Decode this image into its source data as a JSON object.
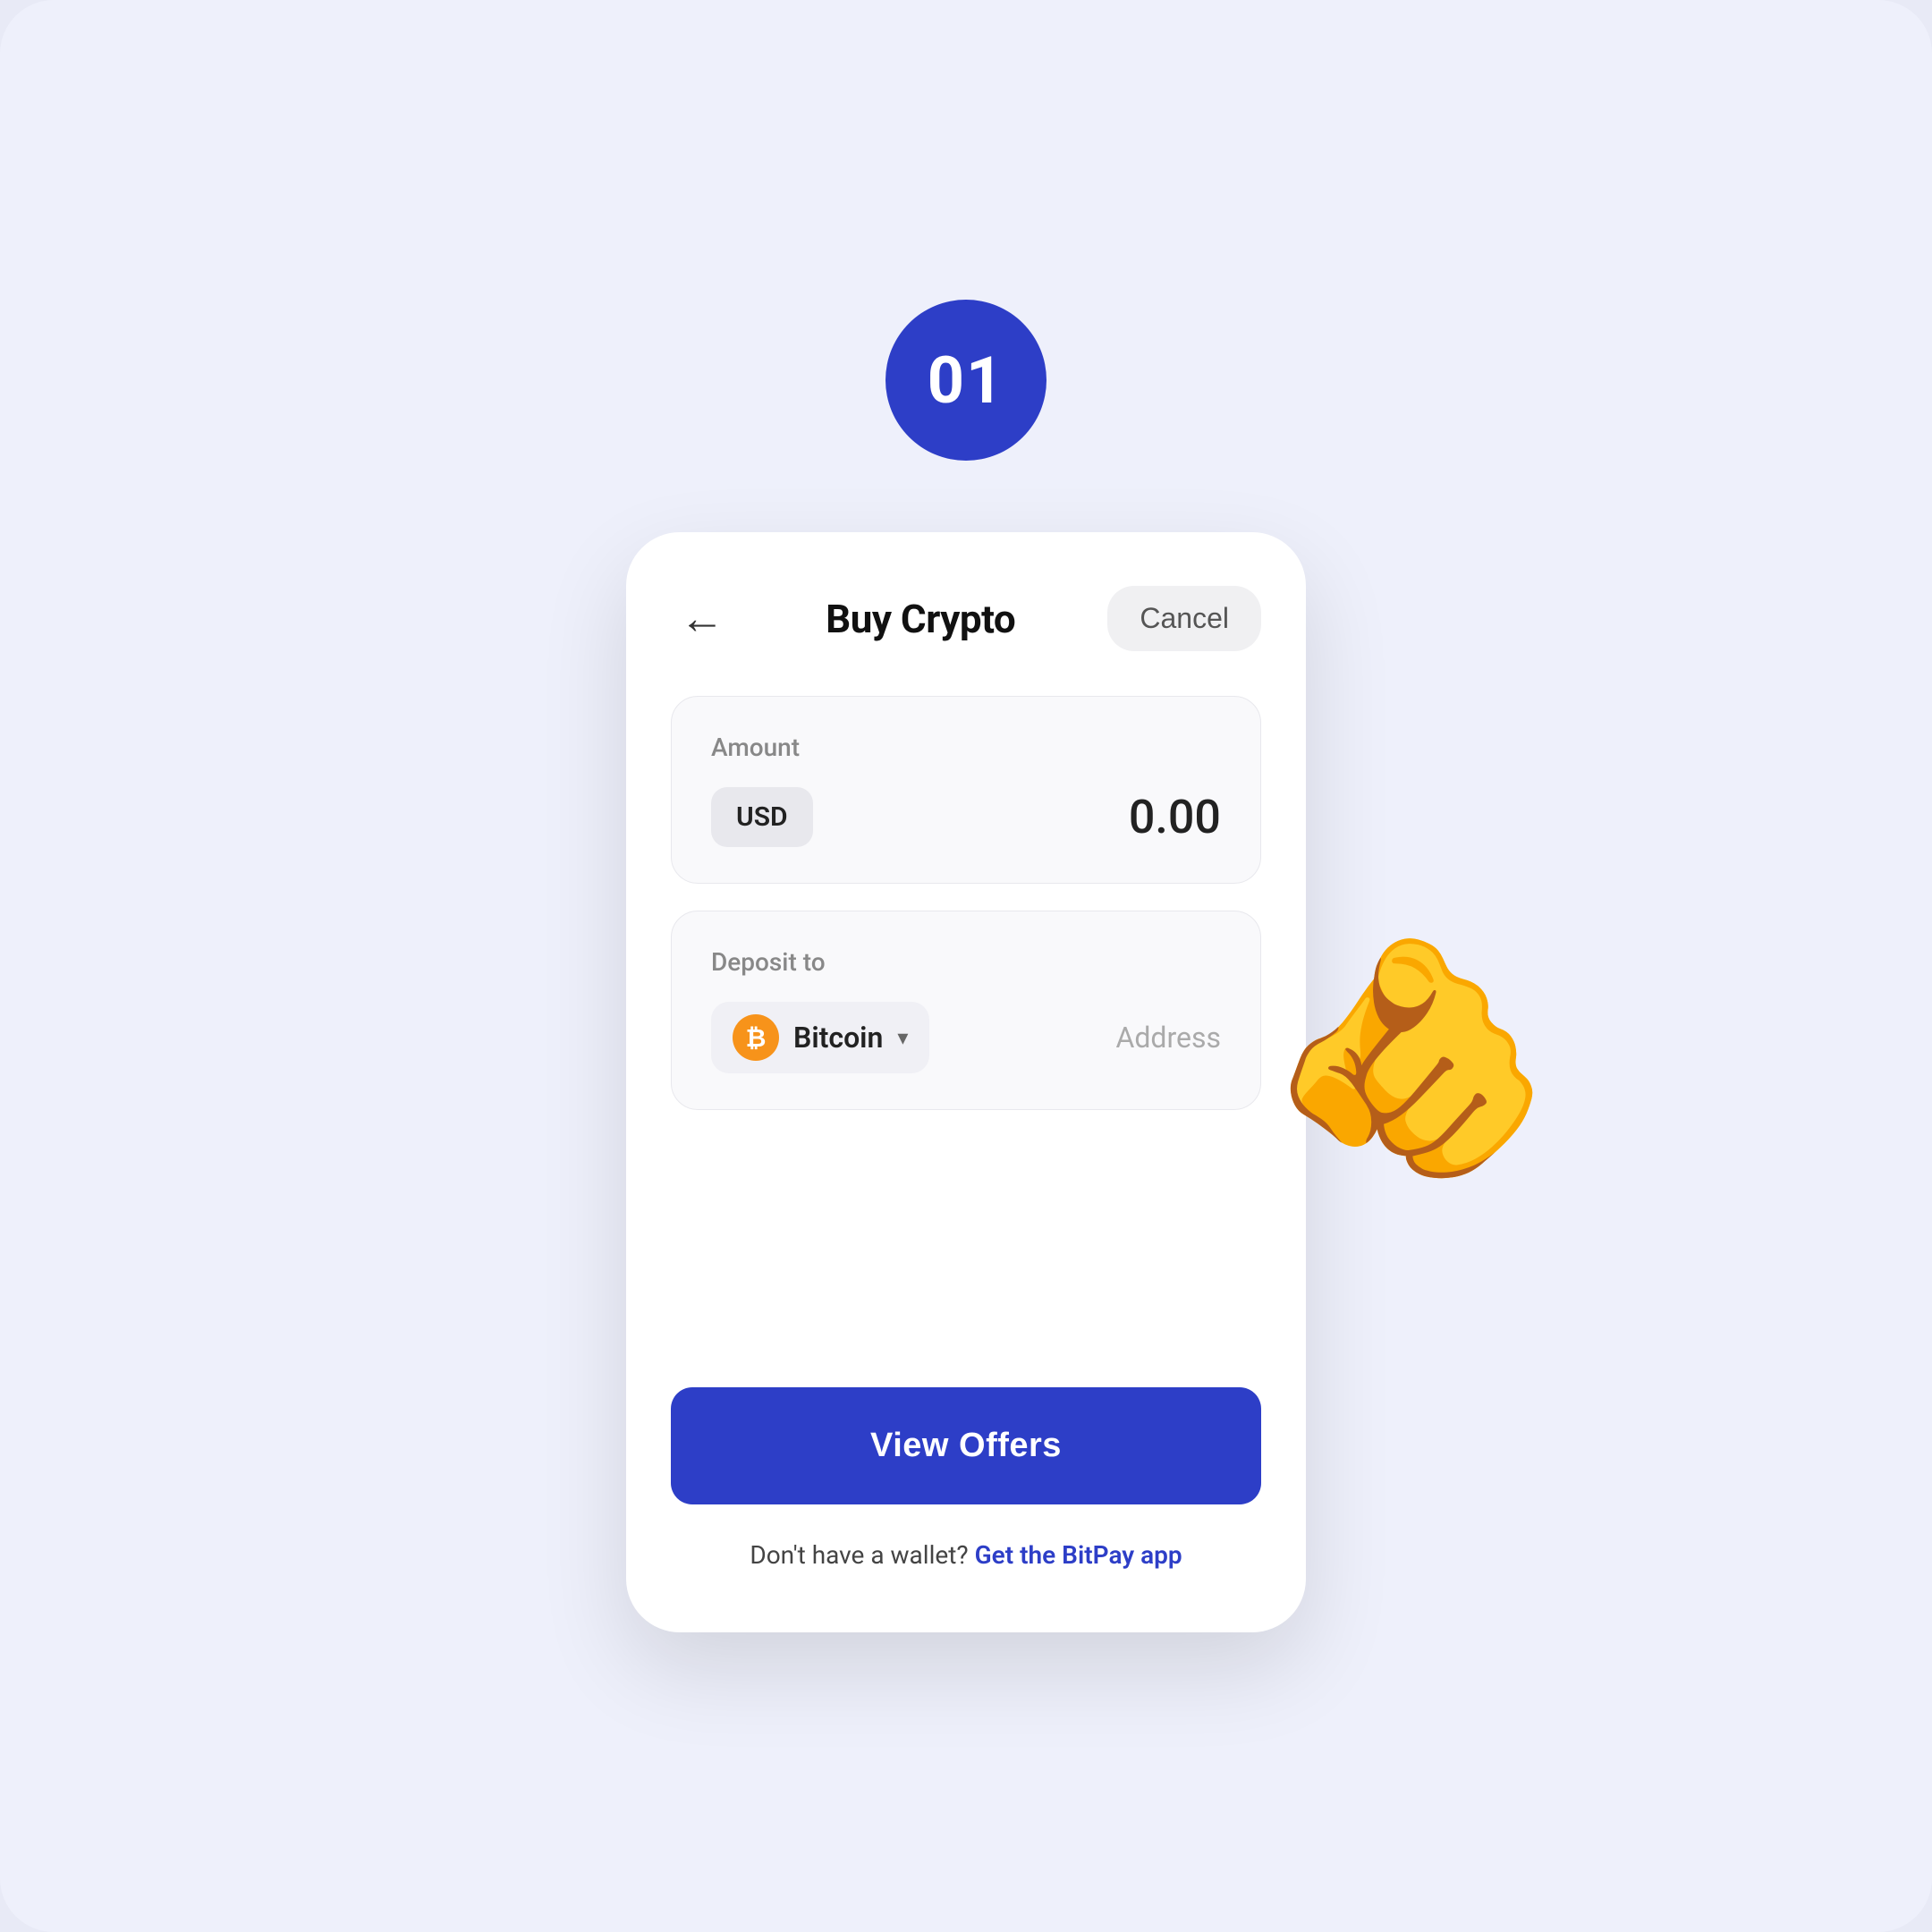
{
  "step": {
    "number": "01"
  },
  "header": {
    "title": "Buy Crypto",
    "cancel_label": "Cancel",
    "back_label": "←"
  },
  "amount_section": {
    "label": "Amount",
    "currency": "USD",
    "value": "0.00"
  },
  "deposit_section": {
    "label": "Deposit to",
    "crypto_name": "Bitcoin",
    "address_placeholder": "Address"
  },
  "footer": {
    "view_offers_label": "View Offers",
    "wallet_prompt": "Don't have a wallet?",
    "wallet_link": "Get the BitPay app"
  }
}
